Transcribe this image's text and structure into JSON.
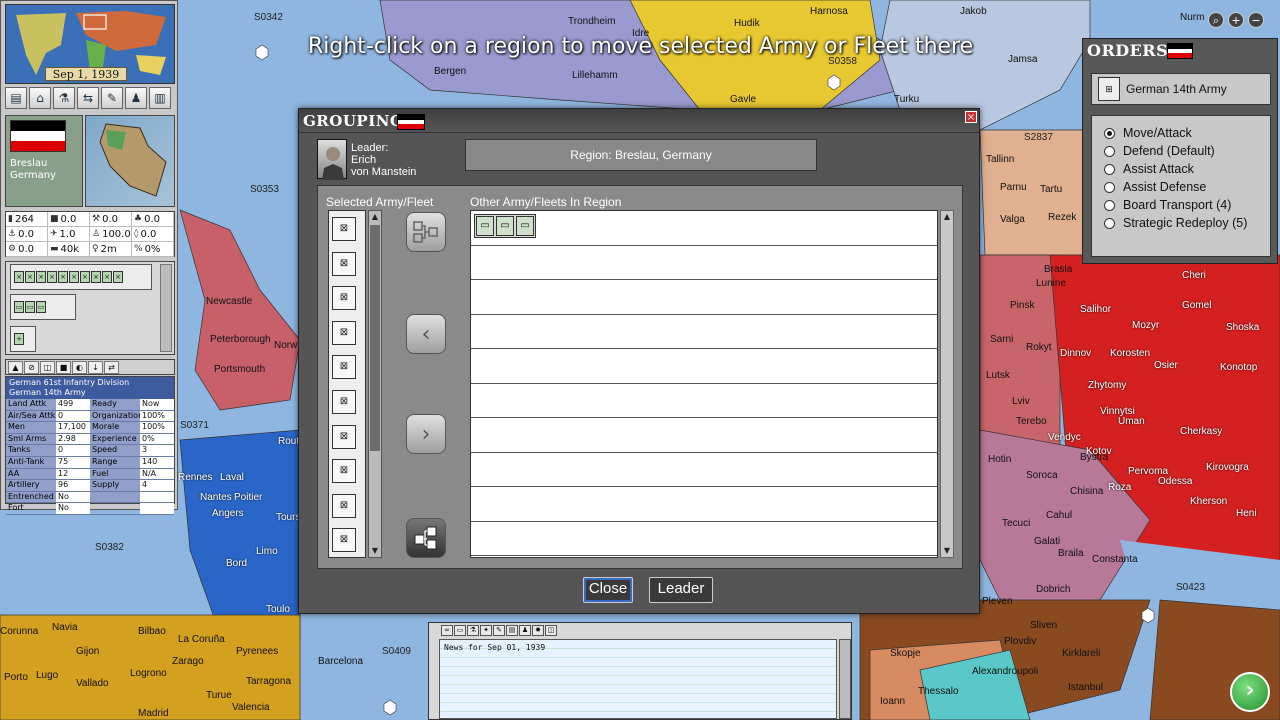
{
  "hint": "Right-click on a region to move selected Army or Fleet there",
  "colors": {
    "germany": "#a0a0a0",
    "france": "#2a66c8",
    "ussr": "#d42020",
    "poland": "#c8656a",
    "spain": "#d4a020",
    "sweden": "#e8c830",
    "norway": "#9a9ad0",
    "finland": "#b8c8e0",
    "uk": "#c8606a",
    "balkans_brown": "#8a4a20",
    "sea": "#8fb6e0"
  },
  "map": {
    "sea_labels": [
      "S0342",
      "S0358",
      "S0353",
      "S0371",
      "S0382",
      "S0409",
      "S0423",
      "S2837"
    ],
    "regions": [
      "Trondheim",
      "Idre",
      "Hudik",
      "Harnosa",
      "Jakob",
      "Nurm",
      "Bergen",
      "Lillehamm",
      "Gavle",
      "Turku",
      "Jamsa",
      "Tallinn",
      "Parnu",
      "Tartu",
      "Valga",
      "Rezek",
      "Newcastle",
      "Peterborough",
      "Portsmouth",
      "Norw",
      "Rennes",
      "Laval",
      "Nantes",
      "Poitier",
      "Angers",
      "Tours",
      "Limo",
      "Bord",
      "Toulo",
      "Rout",
      "Corunna",
      "Navia",
      "Gijon",
      "Bilbao",
      "La Coruña",
      "Zarago",
      "Pyrenees",
      "Barcelona",
      "Porto",
      "Lugo",
      "Vallado",
      "Logrono",
      "Tarragona",
      "Madrid",
      "Valencia",
      "Turue",
      "Lutsk",
      "Pinsk",
      "Sarni",
      "Rokyt",
      "Lviv",
      "Terebo",
      "Hotin",
      "Soroca",
      "Chisina",
      "Galati",
      "Braila",
      "Constanta",
      "Pleven",
      "Dobrich",
      "Sliven",
      "Plovdiv",
      "Kirklareli",
      "Istanbul",
      "Skopje",
      "Thessalo",
      "Alexandroupoli",
      "Ioann",
      "Mozyr",
      "Gomel",
      "Shoska",
      "Salihor",
      "Korosten",
      "Zhytomy",
      "Osier",
      "Konotop",
      "Vinnytsi",
      "Uman",
      "Cherkasy",
      "Kirovogra",
      "Pervoma",
      "Odessa",
      "Kherson",
      "Heni",
      "Kotov",
      "Roza",
      "Vendyc",
      "Tecuci",
      "Cahul",
      "Dinnov",
      "Brasla",
      "Lunine",
      "Bystra",
      "Cheri"
    ]
  },
  "left_panel": {
    "date": "Sep 1, 1939",
    "region_name": "Breslau\nGermany",
    "toolbar_icons": [
      "ledger-icon",
      "factory-icon",
      "research-flask-icon",
      "trade-arrows-icon",
      "notes-icon",
      "diplomacy-icon",
      "chart-icon"
    ],
    "stats": [
      {
        "icon": "infantry-icon",
        "value": "264"
      },
      {
        "icon": "tank-icon",
        "value": "0.0"
      },
      {
        "icon": "tools-icon",
        "value": "0.0"
      },
      {
        "icon": "supply-icon",
        "value": "0.0"
      },
      {
        "icon": "anchor-icon",
        "value": "0.0"
      },
      {
        "icon": "aircraft-icon",
        "value": "1.0"
      },
      {
        "icon": "soldier-icon",
        "value": "100.0"
      },
      {
        "icon": "oil-icon",
        "value": "0.0"
      },
      {
        "icon": "gear-icon",
        "value": "0.0"
      },
      {
        "icon": "money-icon",
        "value": "40k"
      },
      {
        "icon": "person-icon",
        "value": "2m"
      },
      {
        "icon": "percent-icon",
        "value": "0%"
      }
    ],
    "unit_info": {
      "title_lines": [
        "German 61st Infantry Division",
        "German 14th Army"
      ],
      "rows": [
        [
          "Land Attk",
          "499",
          "Ready",
          "Now"
        ],
        [
          "Air/Sea Attk",
          "0",
          "Organization",
          "100%"
        ],
        [
          "Men",
          "17,100",
          "Morale",
          "100%"
        ],
        [
          "Sml Arms",
          "2.98",
          "Experience",
          "0%"
        ],
        [
          "Tanks",
          "0",
          "Speed",
          "3"
        ],
        [
          "Anti-Tank",
          "75",
          "Range",
          "140"
        ],
        [
          "AA",
          "12",
          "Fuel",
          "N/A"
        ],
        [
          "Artillery",
          "96",
          "Supply",
          "4"
        ],
        [
          "Entrenched",
          "No",
          "",
          ""
        ],
        [
          "Fort",
          "No",
          "",
          ""
        ]
      ]
    }
  },
  "orders": {
    "title": "ORDERS",
    "army_name": "German 14th Army",
    "options": [
      {
        "label": "Move/Attack",
        "selected": true
      },
      {
        "label": "Defend (Default)",
        "selected": false
      },
      {
        "label": "Assist Attack",
        "selected": false
      },
      {
        "label": "Assist Defense",
        "selected": false
      },
      {
        "label": "Board Transport (4)",
        "selected": false
      },
      {
        "label": "Strategic Redeploy (5)",
        "selected": false
      }
    ]
  },
  "grouping": {
    "title": "GROUPING",
    "close_x": "×",
    "leader_label": "Leader:",
    "leader_first": "Erich",
    "leader_last": "von Manstein",
    "region": "Region: Breslau, Germany",
    "selected_header": "Selected Army/Fleet",
    "other_header": "Other Army/Fleets In Region",
    "selected_units_count": 10,
    "other_rows": 10,
    "close_label": "Close",
    "leader_button_label": "Leader"
  },
  "news": {
    "text": "News for Sep 01, 1939"
  }
}
